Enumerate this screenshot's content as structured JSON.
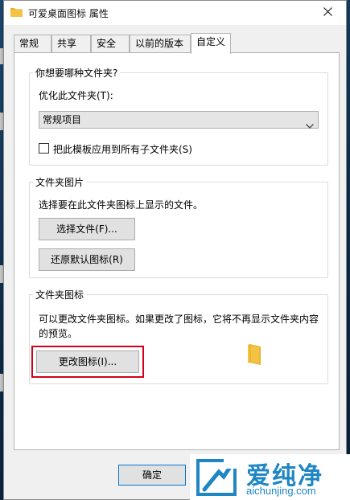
{
  "window": {
    "title": "可爱桌面图标 属性"
  },
  "tabs": [
    {
      "label": "常规"
    },
    {
      "label": "共享"
    },
    {
      "label": "安全"
    },
    {
      "label": "以前的版本"
    },
    {
      "label": "自定义"
    }
  ],
  "group_folder_type": {
    "legend": "你想要哪种文件夹?",
    "optimize_label": "优化此文件夹(T):",
    "optimize_value": "常规项目",
    "apply_checkbox_label": "把此模板应用到所有子文件夹(S)",
    "apply_checked": false
  },
  "group_folder_picture": {
    "legend": "文件夹图片",
    "description": "选择要在此文件夹图标上显示的文件。",
    "choose_file_button": "选择文件(F)...",
    "restore_default_button": "还原默认图标(R)"
  },
  "group_folder_icon": {
    "legend": "文件夹图标",
    "description_line1": "可以更改文件夹图标。如果更改了图标，它将不再显示文件夹内容",
    "description_line2": "的预览。",
    "change_icon_button": "更改图标(I)..."
  },
  "footer": {
    "ok_button": "确定"
  },
  "watermark": {
    "main_text": "爱纯净",
    "sub_text": "aichunjing.com"
  },
  "colors": {
    "highlight": "#d0021b",
    "folder": "#f5c342",
    "watermark": "#1f86c4"
  }
}
